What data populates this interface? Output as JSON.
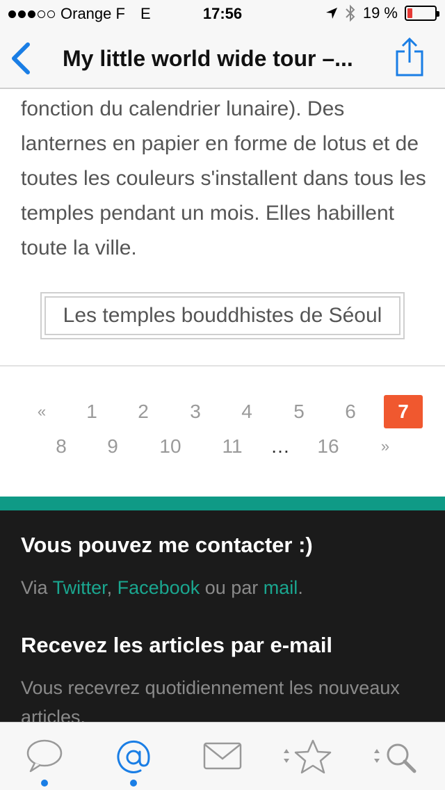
{
  "status_bar": {
    "carrier": "Orange F",
    "network": "E",
    "time": "17:56",
    "battery_percent": "19 %",
    "battery_level": 0.19
  },
  "nav": {
    "title": "My little world wide tour –...",
    "back_icon": "chevron-left-icon",
    "share_icon": "share-icon"
  },
  "article": {
    "paragraph": "fonction du calendrier lunaire). Des lanternes en papier en forme de lotus et de toutes les couleurs s'installent dans tous les temples pendant un mois. Elles habillent toute la ville.",
    "caption_link": "Les temples bouddhistes de Séoul"
  },
  "pagination": {
    "prev": "«",
    "next": "»",
    "ellipsis": "…",
    "pages_row1": [
      "1",
      "2",
      "3",
      "4",
      "5",
      "6",
      "7"
    ],
    "pages_row2": [
      "8",
      "9",
      "10",
      "11",
      "16"
    ],
    "current": "7"
  },
  "footer": {
    "contact_heading": "Vous pouvez me contacter :)",
    "contact_prefix": "Via",
    "twitter": "Twitter",
    "comma": ",",
    "facebook": "Facebook",
    "or_by": "ou par",
    "mail": "mail",
    "period": ".",
    "subscribe_heading": "Recevez les articles par e-mail",
    "subscribe_text": "Vous recevrez quotidiennement les nouveaux articles."
  },
  "tabs": [
    {
      "icon": "speech-bubble-icon"
    },
    {
      "icon": "at-sign-icon"
    },
    {
      "icon": "envelope-icon"
    },
    {
      "icon": "star-icon"
    },
    {
      "icon": "search-icon"
    }
  ],
  "colors": {
    "accent_blue": "#1a7ee5",
    "current_page": "#f0582f",
    "footer_accent": "#0f9a86",
    "footer_bg": "#1b1b1b",
    "link": "#1aa68f"
  }
}
